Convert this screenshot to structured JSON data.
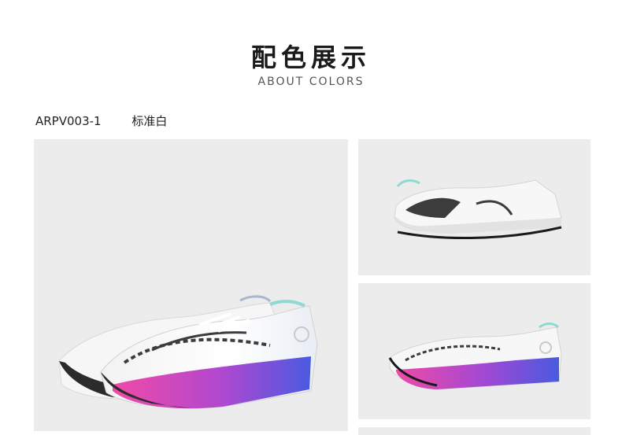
{
  "header": {
    "title": "配色展示",
    "subtitle": "ABOUT COLORS"
  },
  "variant": {
    "code": "ARPV003-1",
    "color_name": "标准白"
  },
  "palette": {
    "background": "#ececec",
    "shoe_upper": "#f7f7f7",
    "gradient_start": "#f04aa6",
    "gradient_mid": "#9a48d8",
    "gradient_end": "#4a5ae0",
    "logo_dark": "#3c3c3c",
    "accent_mint": "#8fd9d2"
  },
  "photos": [
    {
      "name": "main-view"
    },
    {
      "name": "side-view-plain"
    },
    {
      "name": "side-view-gradient"
    }
  ]
}
